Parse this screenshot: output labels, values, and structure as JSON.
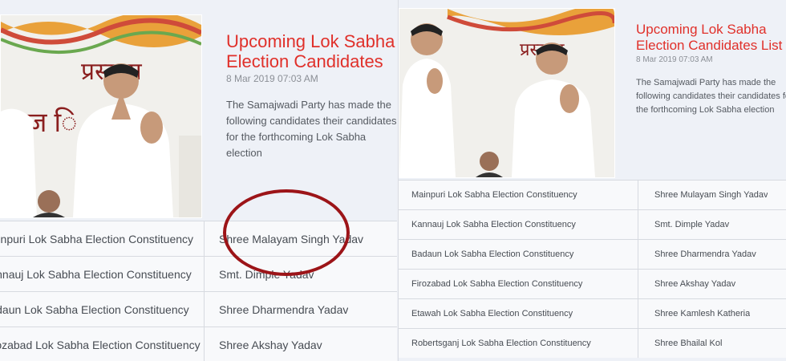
{
  "left_panel": {
    "headline": "Upcoming Lok Sabha Election Candidates",
    "date": "8 Mar 2019 07:03 AM",
    "summary": "The Samajwadi Party has made the following candidates their candidates for the forthcoming Lok Sabha election",
    "rows": [
      {
        "constituency": "Mainpuri Lok Sabha Election Constituency",
        "candidate": "Shree Malayam Singh Yadav"
      },
      {
        "constituency": "Kannauj Lok Sabha Election Constituency",
        "candidate": "Smt. Dimple Yadav"
      },
      {
        "constituency": "Badaun Lok Sabha Election Constituency",
        "candidate": "Shree Dharmendra Yadav"
      },
      {
        "constituency": "Firozabad Lok Sabha Election Constituency",
        "candidate": "Shree Akshay Yadav"
      }
    ]
  },
  "right_panel": {
    "headline": "Upcoming Lok Sabha Election Candidates List",
    "date": "8 Mar 2019 07:03 AM",
    "summary": "The Samajwadi Party has made the following candidates their candidates for the forthcoming Lok Sabha election",
    "rows": [
      {
        "constituency": "Mainpuri Lok Sabha Election Constituency",
        "candidate": "Shree Mulayam Singh Yadav"
      },
      {
        "constituency": "Kannauj Lok Sabha Election Constituency",
        "candidate": "Smt. Dimple Yadav"
      },
      {
        "constituency": "Badaun Lok Sabha Election Constituency",
        "candidate": "Shree Dharmendra Yadav"
      },
      {
        "constituency": "Firozabad Lok Sabha Election Constituency",
        "candidate": "Shree Akshay Yadav"
      },
      {
        "constituency": "Etawah Lok Sabha Election Constituency",
        "candidate": "Shree Kamlesh Katheria"
      },
      {
        "constituency": "Robertsganj Lok Sabha Election Constituency",
        "candidate": "Shree Bhailal Kol"
      }
    ]
  },
  "colors": {
    "headline": "#e0302a",
    "annotation_circle": "#9c1418",
    "background": "#eef1f7"
  }
}
